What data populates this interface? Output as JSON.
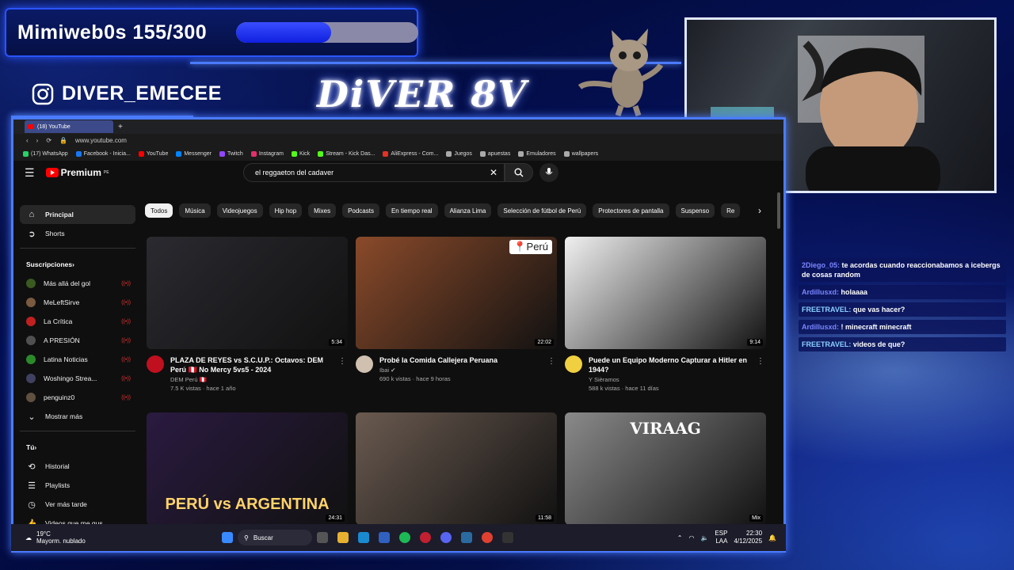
{
  "overlay": {
    "goal_label": "Mimiweb0s 155/300",
    "goal_progress": 0.52,
    "instagram_handle": "DIVER_EMECEE",
    "brand": "DiVER 8V"
  },
  "chat": [
    {
      "user": "2Diego_05:",
      "text": "te acordas cuando reaccionabamos a icebergs de cosas random"
    },
    {
      "user": "Ardillusxd:",
      "text": "holaaaa"
    },
    {
      "user": "FREETRAVEL:",
      "text": "que vas hacer?"
    },
    {
      "user": "Ardillusxd:",
      "text": "! minecraft minecraft"
    },
    {
      "user": "FREETRAVEL:",
      "text": "videos de que?"
    }
  ],
  "browser": {
    "tab_title": "(18) YouTube",
    "url": "www.youtube.com",
    "bookmarks": [
      "(17) WhatsApp",
      "Facebook - Inicia...",
      "YouTube",
      "Messenger",
      "Twitch",
      "Instagram",
      "Kick",
      "Stream - Kick Das...",
      "AliExpress - Com...",
      "Juegos",
      "apuestas",
      "Emuladores",
      "wallpapers"
    ]
  },
  "youtube": {
    "logo": "Premium",
    "logo_region": "PE",
    "search_value": "el reggaeton del cadaver",
    "sidebar": {
      "main": [
        {
          "label": "Principal",
          "icon": "home-icon"
        },
        {
          "label": "Shorts",
          "icon": "shorts-icon"
        }
      ],
      "subs_heading": "Suscripciones",
      "subs": [
        {
          "label": "Más allá del gol",
          "color": "#3a5a20"
        },
        {
          "label": "MeLeftSirve",
          "color": "#7a5a40"
        },
        {
          "label": "La Crítica",
          "color": "#c02020"
        },
        {
          "label": "A PRESIÓN",
          "color": "#505050"
        },
        {
          "label": "Latina Noticias",
          "color": "#2a8a2a"
        },
        {
          "label": "Woshingo Strea...",
          "color": "#404060"
        },
        {
          "label": "penguinz0",
          "color": "#605040"
        }
      ],
      "show_more": "Mostrar más",
      "you_heading": "Tú",
      "you": [
        {
          "label": "Historial",
          "icon": "history-icon"
        },
        {
          "label": "Playlists",
          "icon": "playlists-icon"
        },
        {
          "label": "Ver más tarde",
          "icon": "watch-later-icon"
        },
        {
          "label": "Videos que me gus...",
          "icon": "liked-icon"
        }
      ]
    },
    "chips": [
      "Todos",
      "Música",
      "Videojuegos",
      "Hip hop",
      "Mixes",
      "Podcasts",
      "En tiempo real",
      "Alianza Lima",
      "Selección de fútbol de Perú",
      "Protectores de pantalla",
      "Suspenso",
      "Re"
    ],
    "videos": [
      {
        "title": "PLAZA DE REYES vs S.C.U.P.: Octavos: DEM Perú 🇵🇪 No Mercy 5vs5 - 2024",
        "channel": "DEM Perú 🇵🇪",
        "stats": "7.5 K vistas · hace 1 año",
        "duration": "5:34",
        "thumb": "#2a2a30",
        "avatar": "#c01020"
      },
      {
        "title": "Probé la Comida Callejera Peruana",
        "channel": "Ibai ✔",
        "stats": "690 k vistas · hace 9 horas",
        "duration": "22:02",
        "thumb": "#8a4a2a",
        "avatar": "#d0c0b0",
        "tag": "📍Perú"
      },
      {
        "title": "Puede un Equipo Moderno Capturar a Hitler en 1944?",
        "channel": "Y Sièramos",
        "stats": "588 k vistas · hace 11 días",
        "duration": "9:14",
        "thumb": "#f0f0f0",
        "avatar": "#f0d040"
      },
      {
        "title": "",
        "channel": "",
        "stats": "",
        "duration": "24:31",
        "thumb": "#2a1a40",
        "avatar": "",
        "overlay_text": "PERÚ vs ARGENTINA"
      },
      {
        "title": "",
        "channel": "",
        "stats": "",
        "duration": "11:58",
        "thumb": "#6a5a50",
        "avatar": ""
      },
      {
        "title": "",
        "channel": "",
        "stats": "",
        "duration": "Mix",
        "thumb": "#8a8a8a",
        "avatar": "",
        "overlay_text": "VIRAAG"
      }
    ]
  },
  "taskbar": {
    "weather_temp": "19°C",
    "weather_desc": "Mayorm. nublado",
    "search": "Buscar",
    "lang_top": "ESP",
    "lang_bottom": "LAA",
    "time": "22:30",
    "date": "4/12/2025"
  }
}
